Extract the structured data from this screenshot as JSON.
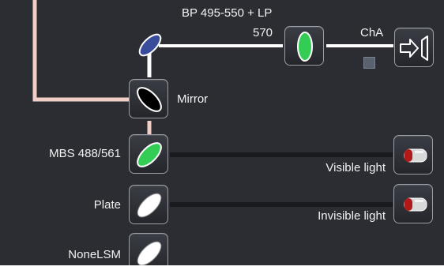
{
  "filter_label_top": "BP 495-550 + LP",
  "filter_label_bottom": "570",
  "channel_label": "ChA",
  "mirror_label": "Mirror",
  "beamsplitters": [
    {
      "label": "MBS 488/561",
      "color": "#33cc55"
    },
    {
      "label": "Plate",
      "color": "#ffffff"
    },
    {
      "label": "NoneLSM",
      "color": "#ffffff"
    }
  ],
  "light_labels": {
    "visible": "Visible light",
    "invisible": "Invisible light"
  },
  "colors": {
    "panel_bg": "#2b2d33",
    "laser_path": "#f2cfc6",
    "emission_path": "#ffffff",
    "dark_path": "#1a1b1f",
    "optic_blue": "#3a4d9a",
    "optic_green": "#33cc55",
    "optic_black": "#000000"
  },
  "icons": [
    "optic-ellipse-icon",
    "detector-arrow-icon",
    "lamp-icon"
  ]
}
